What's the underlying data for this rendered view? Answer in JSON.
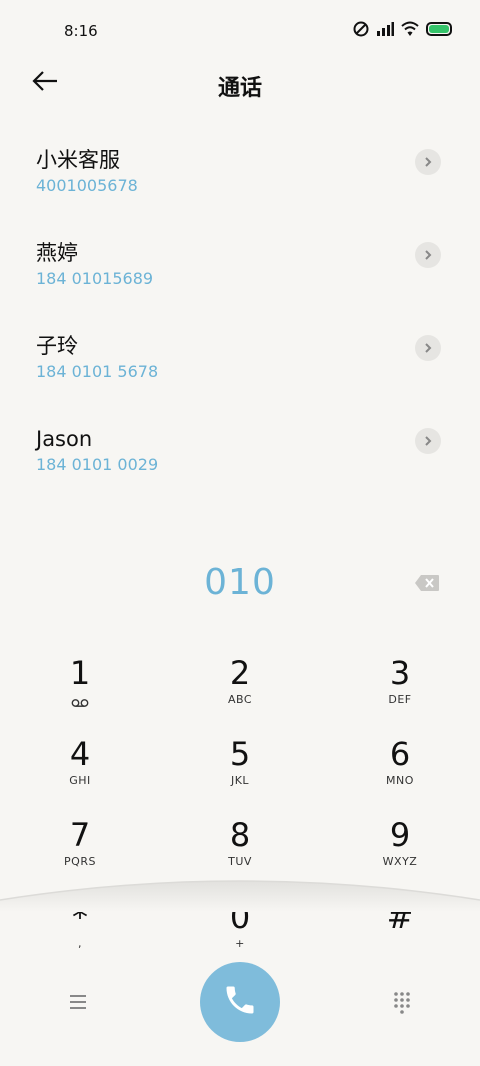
{
  "status_bar": {
    "time": "8:16",
    "icons": [
      "do-not-disturb-icon",
      "signal-icon",
      "wifi-icon",
      "battery-icon"
    ],
    "battery_color": "#35c46a"
  },
  "header": {
    "back_icon": "arrow-left-icon",
    "title": "通话"
  },
  "contacts": [
    {
      "name": "小米客服",
      "number": "4001005678"
    },
    {
      "name": "燕婷",
      "number": "184 01015689"
    },
    {
      "name": "子玲",
      "number": "184 0101 5678"
    },
    {
      "name": "Jason",
      "number": "184 0101 0029"
    }
  ],
  "dialer": {
    "input_value": "010",
    "accent_color": "#6cb3d6",
    "call_button_color": "#7fbcdb"
  },
  "keypad": [
    {
      "digit": "1",
      "letters": ""
    },
    {
      "digit": "2",
      "letters": "ABC"
    },
    {
      "digit": "3",
      "letters": "DEF"
    },
    {
      "digit": "4",
      "letters": "GHI"
    },
    {
      "digit": "5",
      "letters": "JKL"
    },
    {
      "digit": "6",
      "letters": "MNO"
    },
    {
      "digit": "7",
      "letters": "PQRS"
    },
    {
      "digit": "8",
      "letters": "TUV"
    },
    {
      "digit": "9",
      "letters": "WXYZ"
    },
    {
      "digit": "*",
      "letters": ","
    },
    {
      "digit": "0",
      "letters": "+"
    },
    {
      "digit": "#",
      "letters": ""
    }
  ]
}
